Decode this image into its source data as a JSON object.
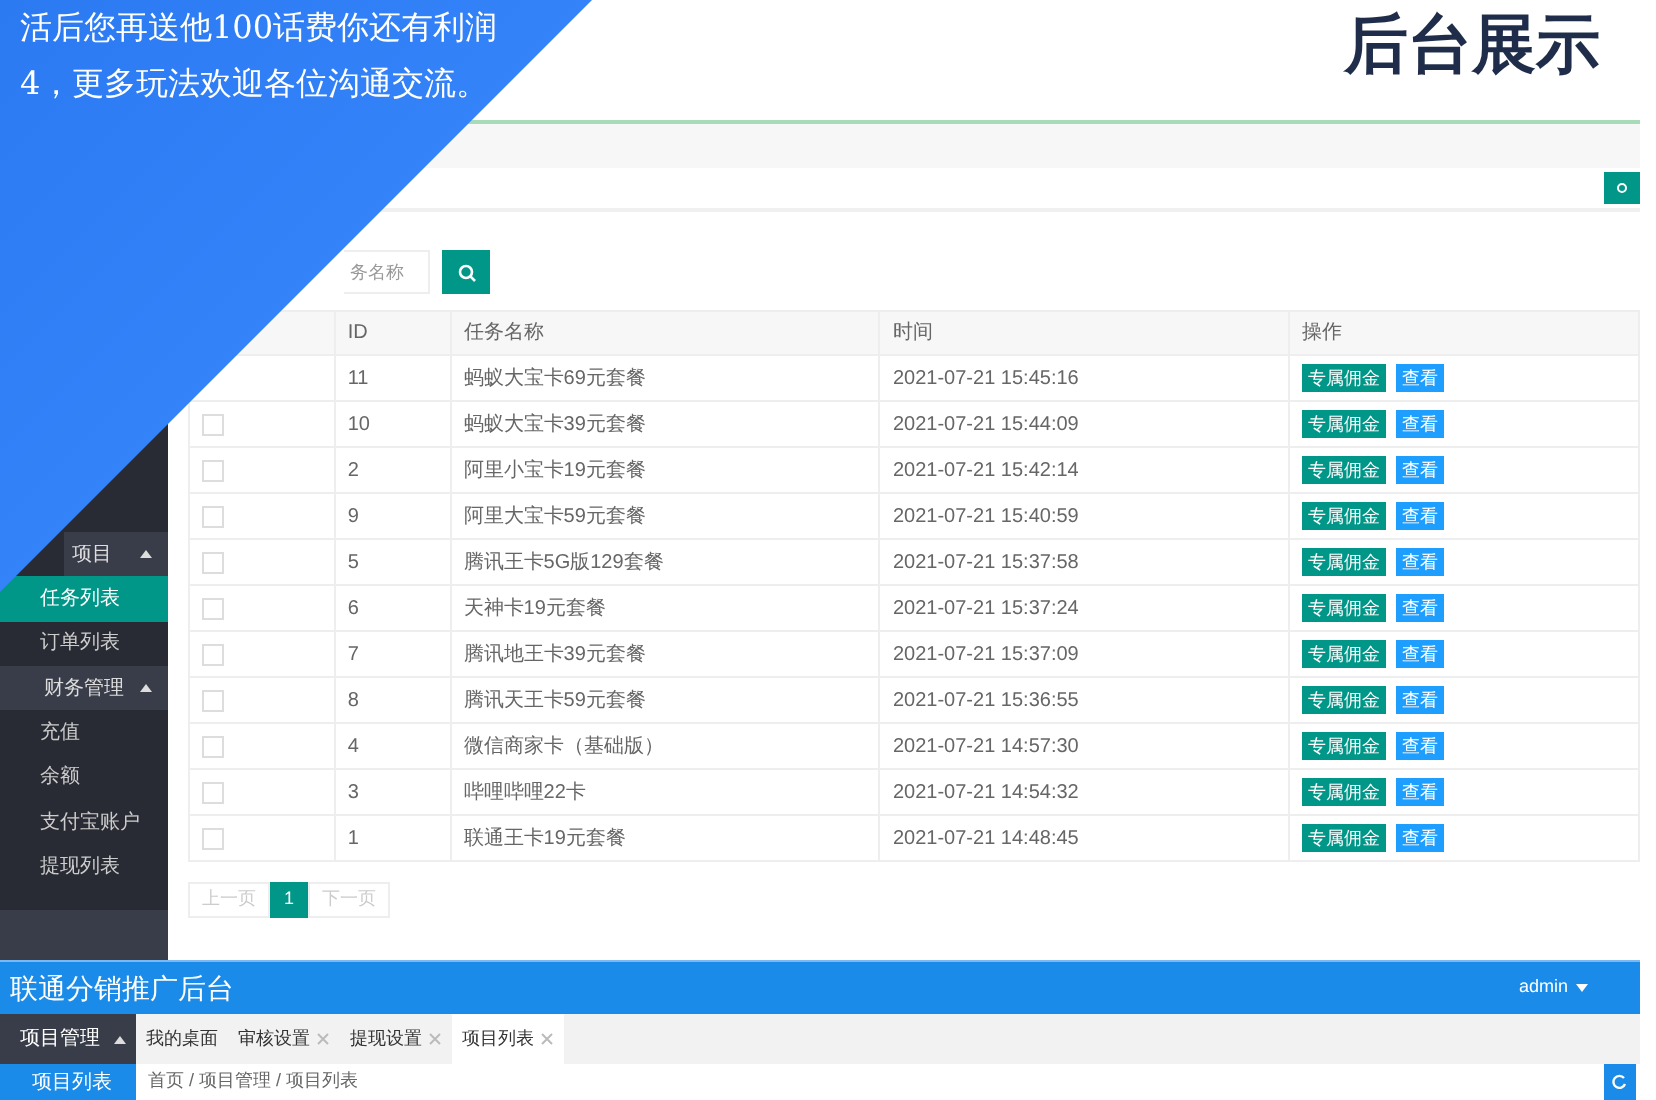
{
  "promo": {
    "lines": [
      "活后您再送他100话费你还有利润",
      "4，更多玩法欢迎各位沟通交流。"
    ]
  },
  "title": "后台展示",
  "top_admin": {
    "sidebar": [
      {
        "label": "项目",
        "kind": "group",
        "expanded": true
      },
      {
        "label": "任务列表",
        "kind": "item",
        "selected": true
      },
      {
        "label": "订单列表",
        "kind": "item",
        "selected": false
      },
      {
        "label": "财务管理",
        "kind": "group",
        "expanded": true
      },
      {
        "label": "充值",
        "kind": "item",
        "selected": false
      },
      {
        "label": "余额",
        "kind": "item",
        "selected": false
      },
      {
        "label": "支付宝账户",
        "kind": "item",
        "selected": false
      },
      {
        "label": "提现列表",
        "kind": "item",
        "selected": false
      }
    ],
    "search": {
      "placeholder": "务名称"
    },
    "table": {
      "columns": [
        "ID",
        "任务名称",
        "时间",
        "操作"
      ],
      "rows": [
        {
          "id": "11",
          "name": "蚂蚁大宝卡69元套餐",
          "time": "2021-07-21 15:45:16",
          "actions": [
            {
              "label": "专属佣金",
              "kind": "commission"
            },
            {
              "label": "查看",
              "kind": "view"
            }
          ]
        },
        {
          "checked": false,
          "id": "10",
          "name": "蚂蚁大宝卡39元套餐",
          "time": "2021-07-21 15:44:09",
          "actions": [
            {
              "label": "专属佣金",
              "kind": "commission"
            },
            {
              "label": "查看",
              "kind": "view"
            }
          ]
        },
        {
          "checked": false,
          "id": "2",
          "name": "阿里小宝卡19元套餐",
          "time": "2021-07-21 15:42:14",
          "actions": [
            {
              "label": "专属佣金",
              "kind": "commission"
            },
            {
              "label": "查看",
              "kind": "view"
            }
          ]
        },
        {
          "checked": false,
          "id": "9",
          "name": "阿里大宝卡59元套餐",
          "time": "2021-07-21 15:40:59",
          "actions": [
            {
              "label": "专属佣金",
              "kind": "commission"
            },
            {
              "label": "查看",
              "kind": "view"
            }
          ]
        },
        {
          "checked": false,
          "id": "5",
          "name": "腾讯王卡5G版129套餐",
          "time": "2021-07-21 15:37:58",
          "actions": [
            {
              "label": "专属佣金",
              "kind": "commission"
            },
            {
              "label": "查看",
              "kind": "view"
            }
          ]
        },
        {
          "checked": false,
          "id": "6",
          "name": "天神卡19元套餐",
          "time": "2021-07-21 15:37:24",
          "actions": [
            {
              "label": "专属佣金",
              "kind": "commission"
            },
            {
              "label": "查看",
              "kind": "view"
            }
          ]
        },
        {
          "checked": false,
          "id": "7",
          "name": "腾讯地王卡39元套餐",
          "time": "2021-07-21 15:37:09",
          "actions": [
            {
              "label": "专属佣金",
              "kind": "commission"
            },
            {
              "label": "查看",
              "kind": "view"
            }
          ]
        },
        {
          "checked": false,
          "id": "8",
          "name": "腾讯天王卡59元套餐",
          "time": "2021-07-21 15:36:55",
          "actions": [
            {
              "label": "专属佣金",
              "kind": "commission"
            },
            {
              "label": "查看",
              "kind": "view"
            }
          ]
        },
        {
          "checked": false,
          "id": "4",
          "name": "微信商家卡（基础版）",
          "time": "2021-07-21 14:57:30",
          "actions": [
            {
              "label": "专属佣金",
              "kind": "commission"
            },
            {
              "label": "查看",
              "kind": "view"
            }
          ]
        },
        {
          "checked": false,
          "id": "3",
          "name": "哔哩哔哩22卡",
          "time": "2021-07-21 14:54:32",
          "actions": [
            {
              "label": "专属佣金",
              "kind": "commission"
            },
            {
              "label": "查看",
              "kind": "view"
            }
          ]
        },
        {
          "checked": false,
          "id": "1",
          "name": "联通王卡19元套餐",
          "time": "2021-07-21 14:48:45",
          "actions": [
            {
              "label": "专属佣金",
              "kind": "commission"
            },
            {
              "label": "查看",
              "kind": "view"
            }
          ]
        }
      ]
    },
    "pagination": [
      {
        "label": "上一页",
        "selected": false,
        "disabled": true
      },
      {
        "label": "1",
        "selected": true,
        "disabled": false
      },
      {
        "label": "下一页",
        "selected": false,
        "disabled": true
      }
    ]
  },
  "bottom_admin": {
    "brand": "联通分销推广后台",
    "user": "admin",
    "sidebar": [
      {
        "label": "项目管理",
        "kind": "group",
        "expanded": true
      },
      {
        "label": "项目列表",
        "kind": "item",
        "selected": true
      }
    ],
    "tabs": [
      {
        "label": "我的桌面",
        "closable": false,
        "selected": false
      },
      {
        "label": "审核设置",
        "closable": true,
        "selected": false
      },
      {
        "label": "提现设置",
        "closable": true,
        "selected": false
      },
      {
        "label": "项目列表",
        "closable": true,
        "selected": true
      }
    ],
    "breadcrumb": "首页 / 项目管理 / 项目列表"
  }
}
